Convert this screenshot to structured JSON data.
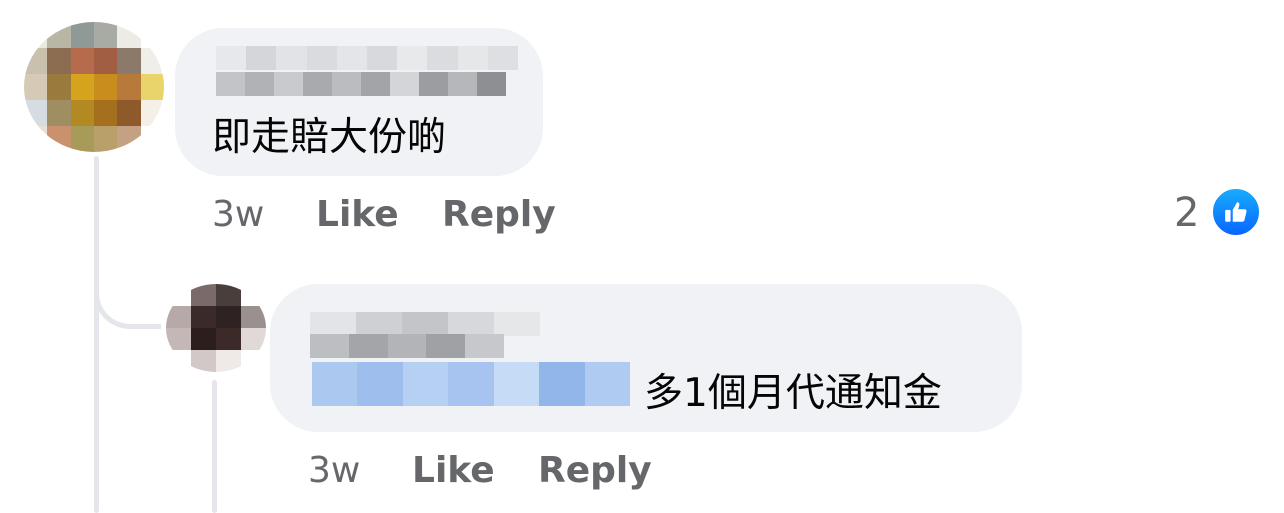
{
  "comments": [
    {
      "text": "即走賠大份啲",
      "time": "3w",
      "like_label": "Like",
      "reply_label": "Reply",
      "reactions_count": "2"
    },
    {
      "text": "多1個月代通知金",
      "time": "3w",
      "like_label": "Like",
      "reply_label": "Reply"
    }
  ],
  "colors": {
    "bubble": "#f0f2f5",
    "meta_text": "#65676b",
    "like_blue": "#0866ff",
    "mention_blue": "#8fb8ea"
  },
  "icons": [
    "thumbs-up-icon"
  ]
}
